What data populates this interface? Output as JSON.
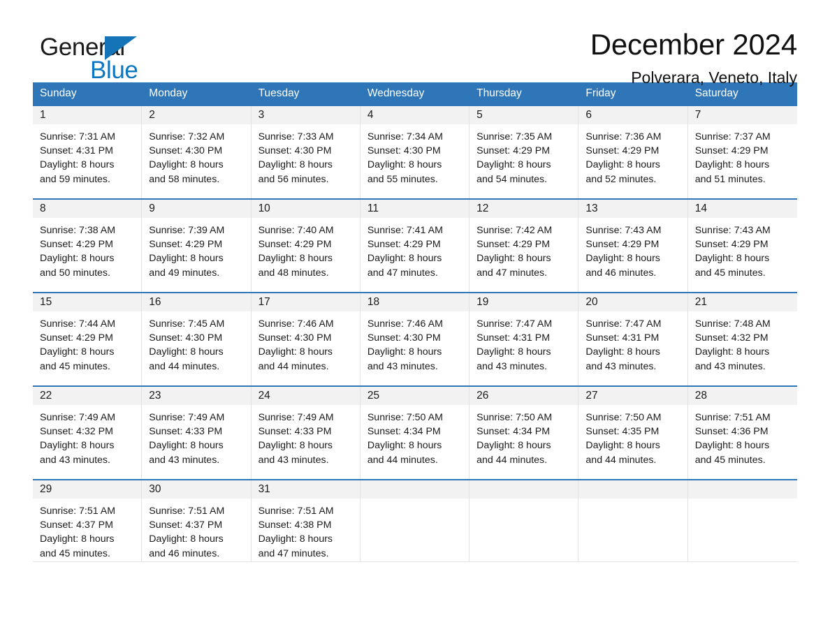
{
  "brand": {
    "word_one": "General",
    "word_two": "Blue",
    "triangle_color": "#1574b8",
    "blue_text_color": "#0b77c2"
  },
  "header": {
    "title": "December 2024",
    "subtitle": "Polverara, Veneto, Italy"
  },
  "theme": {
    "header_blue": "#2e76b8",
    "daynum_band": "#f2f2f2",
    "cell_border": "#e2e2e2",
    "text": "#1a1a1a"
  },
  "weekdays": [
    "Sunday",
    "Monday",
    "Tuesday",
    "Wednesday",
    "Thursday",
    "Friday",
    "Saturday"
  ],
  "weeks": [
    {
      "days": [
        {
          "num": "1",
          "sunrise": "Sunrise: 7:31 AM",
          "sunset": "Sunset: 4:31 PM",
          "daylight1": "Daylight: 8 hours",
          "daylight2": "and 59 minutes."
        },
        {
          "num": "2",
          "sunrise": "Sunrise: 7:32 AM",
          "sunset": "Sunset: 4:30 PM",
          "daylight1": "Daylight: 8 hours",
          "daylight2": "and 58 minutes."
        },
        {
          "num": "3",
          "sunrise": "Sunrise: 7:33 AM",
          "sunset": "Sunset: 4:30 PM",
          "daylight1": "Daylight: 8 hours",
          "daylight2": "and 56 minutes."
        },
        {
          "num": "4",
          "sunrise": "Sunrise: 7:34 AM",
          "sunset": "Sunset: 4:30 PM",
          "daylight1": "Daylight: 8 hours",
          "daylight2": "and 55 minutes."
        },
        {
          "num": "5",
          "sunrise": "Sunrise: 7:35 AM",
          "sunset": "Sunset: 4:29 PM",
          "daylight1": "Daylight: 8 hours",
          "daylight2": "and 54 minutes."
        },
        {
          "num": "6",
          "sunrise": "Sunrise: 7:36 AM",
          "sunset": "Sunset: 4:29 PM",
          "daylight1": "Daylight: 8 hours",
          "daylight2": "and 52 minutes."
        },
        {
          "num": "7",
          "sunrise": "Sunrise: 7:37 AM",
          "sunset": "Sunset: 4:29 PM",
          "daylight1": "Daylight: 8 hours",
          "daylight2": "and 51 minutes."
        }
      ]
    },
    {
      "days": [
        {
          "num": "8",
          "sunrise": "Sunrise: 7:38 AM",
          "sunset": "Sunset: 4:29 PM",
          "daylight1": "Daylight: 8 hours",
          "daylight2": "and 50 minutes."
        },
        {
          "num": "9",
          "sunrise": "Sunrise: 7:39 AM",
          "sunset": "Sunset: 4:29 PM",
          "daylight1": "Daylight: 8 hours",
          "daylight2": "and 49 minutes."
        },
        {
          "num": "10",
          "sunrise": "Sunrise: 7:40 AM",
          "sunset": "Sunset: 4:29 PM",
          "daylight1": "Daylight: 8 hours",
          "daylight2": "and 48 minutes."
        },
        {
          "num": "11",
          "sunrise": "Sunrise: 7:41 AM",
          "sunset": "Sunset: 4:29 PM",
          "daylight1": "Daylight: 8 hours",
          "daylight2": "and 47 minutes."
        },
        {
          "num": "12",
          "sunrise": "Sunrise: 7:42 AM",
          "sunset": "Sunset: 4:29 PM",
          "daylight1": "Daylight: 8 hours",
          "daylight2": "and 47 minutes."
        },
        {
          "num": "13",
          "sunrise": "Sunrise: 7:43 AM",
          "sunset": "Sunset: 4:29 PM",
          "daylight1": "Daylight: 8 hours",
          "daylight2": "and 46 minutes."
        },
        {
          "num": "14",
          "sunrise": "Sunrise: 7:43 AM",
          "sunset": "Sunset: 4:29 PM",
          "daylight1": "Daylight: 8 hours",
          "daylight2": "and 45 minutes."
        }
      ]
    },
    {
      "days": [
        {
          "num": "15",
          "sunrise": "Sunrise: 7:44 AM",
          "sunset": "Sunset: 4:29 PM",
          "daylight1": "Daylight: 8 hours",
          "daylight2": "and 45 minutes."
        },
        {
          "num": "16",
          "sunrise": "Sunrise: 7:45 AM",
          "sunset": "Sunset: 4:30 PM",
          "daylight1": "Daylight: 8 hours",
          "daylight2": "and 44 minutes."
        },
        {
          "num": "17",
          "sunrise": "Sunrise: 7:46 AM",
          "sunset": "Sunset: 4:30 PM",
          "daylight1": "Daylight: 8 hours",
          "daylight2": "and 44 minutes."
        },
        {
          "num": "18",
          "sunrise": "Sunrise: 7:46 AM",
          "sunset": "Sunset: 4:30 PM",
          "daylight1": "Daylight: 8 hours",
          "daylight2": "and 43 minutes."
        },
        {
          "num": "19",
          "sunrise": "Sunrise: 7:47 AM",
          "sunset": "Sunset: 4:31 PM",
          "daylight1": "Daylight: 8 hours",
          "daylight2": "and 43 minutes."
        },
        {
          "num": "20",
          "sunrise": "Sunrise: 7:47 AM",
          "sunset": "Sunset: 4:31 PM",
          "daylight1": "Daylight: 8 hours",
          "daylight2": "and 43 minutes."
        },
        {
          "num": "21",
          "sunrise": "Sunrise: 7:48 AM",
          "sunset": "Sunset: 4:32 PM",
          "daylight1": "Daylight: 8 hours",
          "daylight2": "and 43 minutes."
        }
      ]
    },
    {
      "days": [
        {
          "num": "22",
          "sunrise": "Sunrise: 7:49 AM",
          "sunset": "Sunset: 4:32 PM",
          "daylight1": "Daylight: 8 hours",
          "daylight2": "and 43 minutes."
        },
        {
          "num": "23",
          "sunrise": "Sunrise: 7:49 AM",
          "sunset": "Sunset: 4:33 PM",
          "daylight1": "Daylight: 8 hours",
          "daylight2": "and 43 minutes."
        },
        {
          "num": "24",
          "sunrise": "Sunrise: 7:49 AM",
          "sunset": "Sunset: 4:33 PM",
          "daylight1": "Daylight: 8 hours",
          "daylight2": "and 43 minutes."
        },
        {
          "num": "25",
          "sunrise": "Sunrise: 7:50 AM",
          "sunset": "Sunset: 4:34 PM",
          "daylight1": "Daylight: 8 hours",
          "daylight2": "and 44 minutes."
        },
        {
          "num": "26",
          "sunrise": "Sunrise: 7:50 AM",
          "sunset": "Sunset: 4:34 PM",
          "daylight1": "Daylight: 8 hours",
          "daylight2": "and 44 minutes."
        },
        {
          "num": "27",
          "sunrise": "Sunrise: 7:50 AM",
          "sunset": "Sunset: 4:35 PM",
          "daylight1": "Daylight: 8 hours",
          "daylight2": "and 44 minutes."
        },
        {
          "num": "28",
          "sunrise": "Sunrise: 7:51 AM",
          "sunset": "Sunset: 4:36 PM",
          "daylight1": "Daylight: 8 hours",
          "daylight2": "and 45 minutes."
        }
      ]
    },
    {
      "days": [
        {
          "num": "29",
          "sunrise": "Sunrise: 7:51 AM",
          "sunset": "Sunset: 4:37 PM",
          "daylight1": "Daylight: 8 hours",
          "daylight2": "and 45 minutes."
        },
        {
          "num": "30",
          "sunrise": "Sunrise: 7:51 AM",
          "sunset": "Sunset: 4:37 PM",
          "daylight1": "Daylight: 8 hours",
          "daylight2": "and 46 minutes."
        },
        {
          "num": "31",
          "sunrise": "Sunrise: 7:51 AM",
          "sunset": "Sunset: 4:38 PM",
          "daylight1": "Daylight: 8 hours",
          "daylight2": "and 47 minutes."
        },
        {
          "num": "",
          "sunrise": "",
          "sunset": "",
          "daylight1": "",
          "daylight2": ""
        },
        {
          "num": "",
          "sunrise": "",
          "sunset": "",
          "daylight1": "",
          "daylight2": ""
        },
        {
          "num": "",
          "sunrise": "",
          "sunset": "",
          "daylight1": "",
          "daylight2": ""
        },
        {
          "num": "",
          "sunrise": "",
          "sunset": "",
          "daylight1": "",
          "daylight2": ""
        }
      ]
    }
  ]
}
